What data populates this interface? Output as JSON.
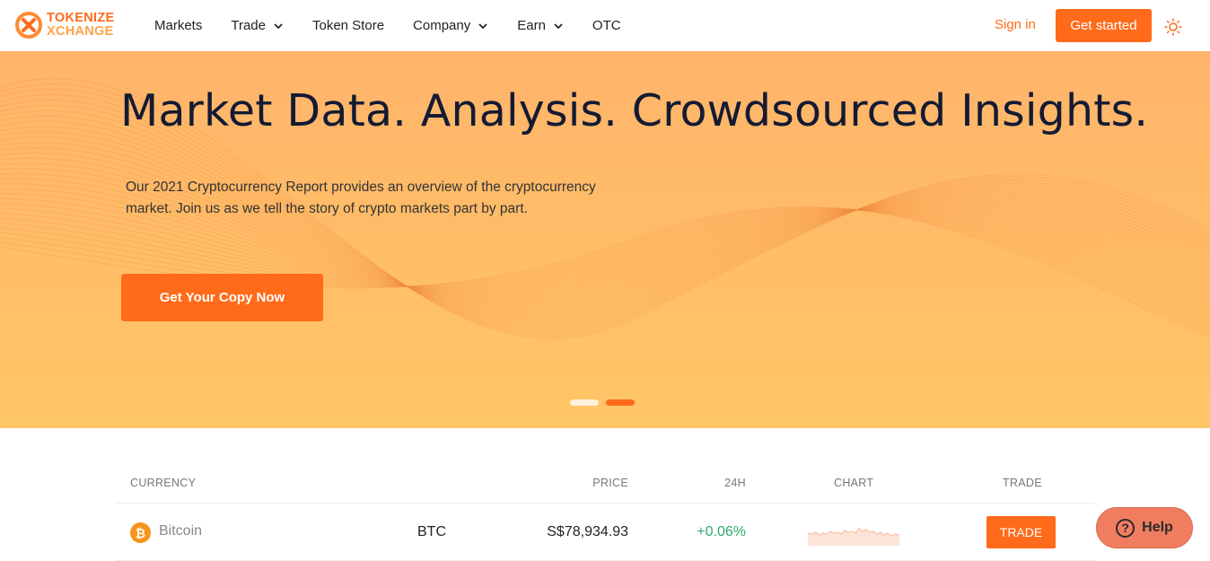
{
  "header": {
    "logo_line1": "TOKENIZE",
    "logo_line2": "XCHANGE",
    "nav": [
      {
        "label": "Markets",
        "has_dropdown": false
      },
      {
        "label": "Trade",
        "has_dropdown": true
      },
      {
        "label": "Token Store",
        "has_dropdown": false
      },
      {
        "label": "Company",
        "has_dropdown": true
      },
      {
        "label": "Earn",
        "has_dropdown": true
      },
      {
        "label": "OTC",
        "has_dropdown": false
      }
    ],
    "signin_label": "Sign in",
    "get_started_label": "Get started",
    "theme_icon": "sun-icon"
  },
  "hero": {
    "title": "Market Data. Analysis. Crowdsourced Insights.",
    "description": "Our 2021 Cryptocurrency Report provides an overview of the cryptocurrency market. Join us as we tell the story of crypto markets part by part.",
    "cta_label": "Get Your Copy Now",
    "slides": 2,
    "active_slide": 2
  },
  "market_table": {
    "headers": {
      "currency": "CURRENCY",
      "price": "PRICE",
      "change": "24H",
      "chart": "CHART",
      "trade": "TRADE"
    },
    "rows": [
      {
        "icon": "bitcoin-icon",
        "icon_glyph": "₿",
        "name": "Bitcoin",
        "symbol": "BTC",
        "price": "S$78,934.93",
        "change": "+0.06%",
        "trade_label": "TRADE"
      }
    ]
  },
  "help": {
    "icon": "question-icon",
    "icon_glyph": "?",
    "label": "Help"
  },
  "colors": {
    "accent": "#ff6b1a",
    "hero_top": "#ffb46a",
    "hero_bottom": "#ffc666",
    "positive": "#2eaa6a",
    "bitcoin": "#f7931a",
    "help_bg": "#f07d60"
  }
}
